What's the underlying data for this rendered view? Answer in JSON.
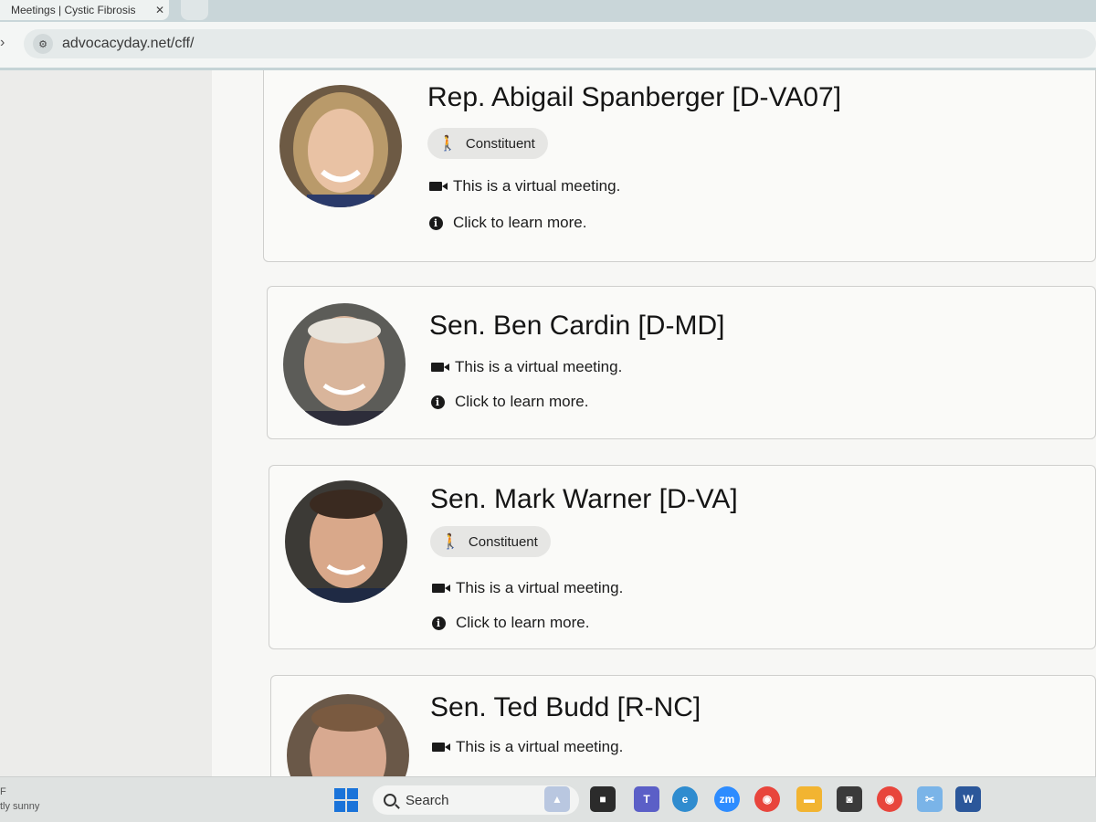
{
  "browser": {
    "tab_title": "Meetings | Cystic Fibrosis",
    "url": "advocacyday.net/cff/"
  },
  "meetings": [
    {
      "name": "Rep. Abigail Spanberger [D-VA07]",
      "badge": "Constituent",
      "virtual": "This is a virtual meeting.",
      "learn_more": "Click to learn more."
    },
    {
      "name": "Sen. Ben Cardin [D-MD]",
      "virtual": "This is a virtual meeting.",
      "learn_more": "Click to learn more."
    },
    {
      "name": "Sen. Mark Warner [D-VA]",
      "badge": "Constituent",
      "virtual": "This is a virtual meeting.",
      "learn_more": "Click to learn more."
    },
    {
      "name": "Sen. Ted Budd [R-NC]",
      "virtual": "This is a virtual meeting."
    }
  ],
  "taskbar": {
    "weather_text": "tly sunny",
    "search_label": "Search",
    "icons": [
      "windows-start-icon",
      "search-icon",
      "widgets-icon",
      "task-view-icon",
      "teams-icon",
      "edge-icon",
      "zoom-icon",
      "chrome-icon",
      "file-explorer-icon",
      "camera-icon",
      "chrome-profile-icon",
      "snipping-tool-icon",
      "word-icon"
    ]
  },
  "colors": {
    "badge_bg": "#e6e6e4",
    "card_border": "#cfcfcd",
    "taskbar_accent": "#1a73d9"
  }
}
